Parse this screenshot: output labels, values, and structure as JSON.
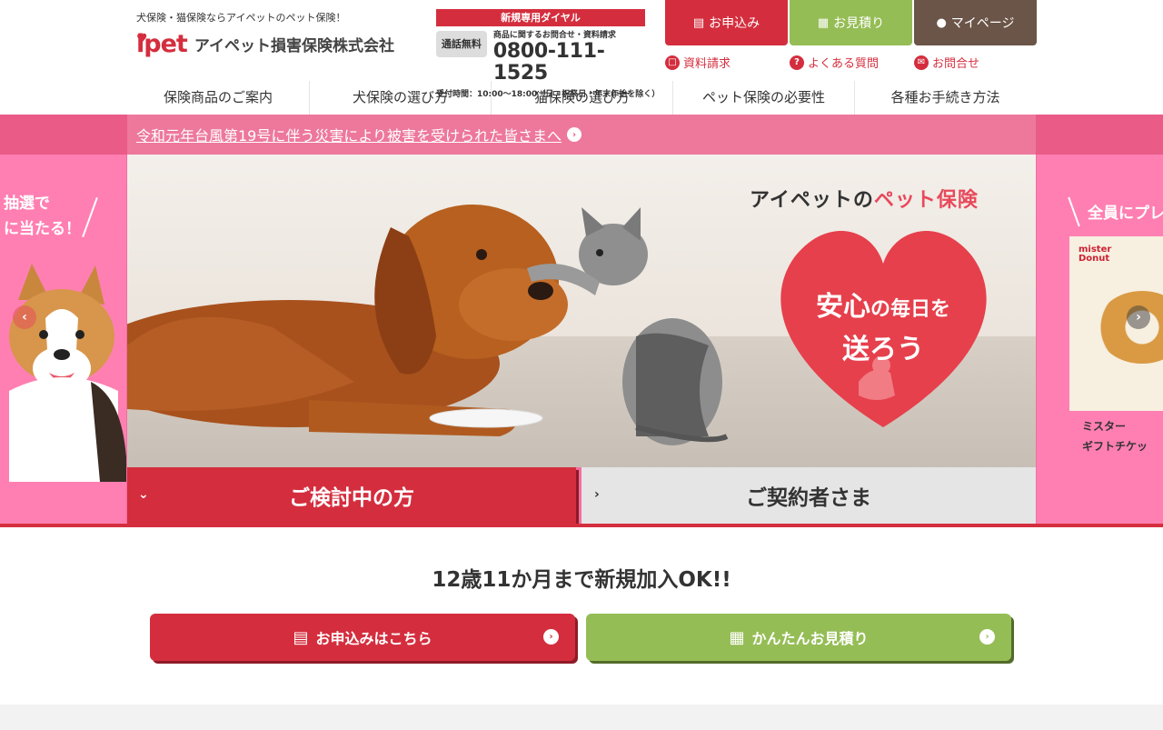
{
  "header": {
    "tagline": "犬保険・猫保険ならアイペットのペット保険！",
    "logo_mark": "ipet",
    "logo_company": "アイペット損害保険株式会社",
    "dial": {
      "title": "新規専用ダイヤル",
      "free_badge": "通話無料",
      "subtitle": "商品に関するお問合せ・資料請求",
      "number": "0800-111-1525",
      "hours": "受付時間：10:00〜18:00（日・祝祭日・年末年始を除く）"
    },
    "top_buttons": [
      {
        "label": "お申込み",
        "icon": "document-icon",
        "color": "#d42e3e"
      },
      {
        "label": "お見積り",
        "icon": "calculator-icon",
        "color": "#95bd55"
      },
      {
        "label": "マイページ",
        "icon": "person-icon",
        "color": "#6b5548"
      }
    ],
    "sub_links": [
      {
        "label": "資料請求",
        "icon": "book-icon"
      },
      {
        "label": "よくある質問",
        "icon": "question-icon"
      },
      {
        "label": "お問合せ",
        "icon": "mail-icon"
      }
    ],
    "nav": [
      "保険商品のご案内",
      "犬保険の選び方",
      "猫保険の選び方",
      "ペット保険の必要性",
      "各種お手続き方法"
    ]
  },
  "hero": {
    "notice": "令和元年台風第19号に伴う災害により被害を受けられた皆さまへ",
    "left_banner_text": [
      "抽選で",
      "に当たる！"
    ],
    "right_banner_text": "全員にプレ",
    "right_banner_brand": [
      "mister",
      "Donut"
    ],
    "right_banner_caption": [
      "ミスター",
      "ギフトチケッ"
    ],
    "slide_heading_prefix": "アイペットの",
    "slide_heading_highlight": "ペット保険",
    "heart_line1_a": "安心",
    "heart_line1_b": "の毎日を",
    "heart_line2": "送ろう",
    "tabs": [
      {
        "label": "ご検討中の方",
        "active": true
      },
      {
        "label": "ご契約者さま",
        "active": false
      }
    ]
  },
  "cta": {
    "heading": "12歳11か月まで新規加入OK!!",
    "apply_label": "お申込みはこちら",
    "estimate_label": "かんたんお見積り"
  },
  "colors": {
    "brand_red": "#d42e3e",
    "brand_green": "#95bd55",
    "brand_brown": "#6b5548",
    "hero_pink": "#ff7fb2"
  }
}
